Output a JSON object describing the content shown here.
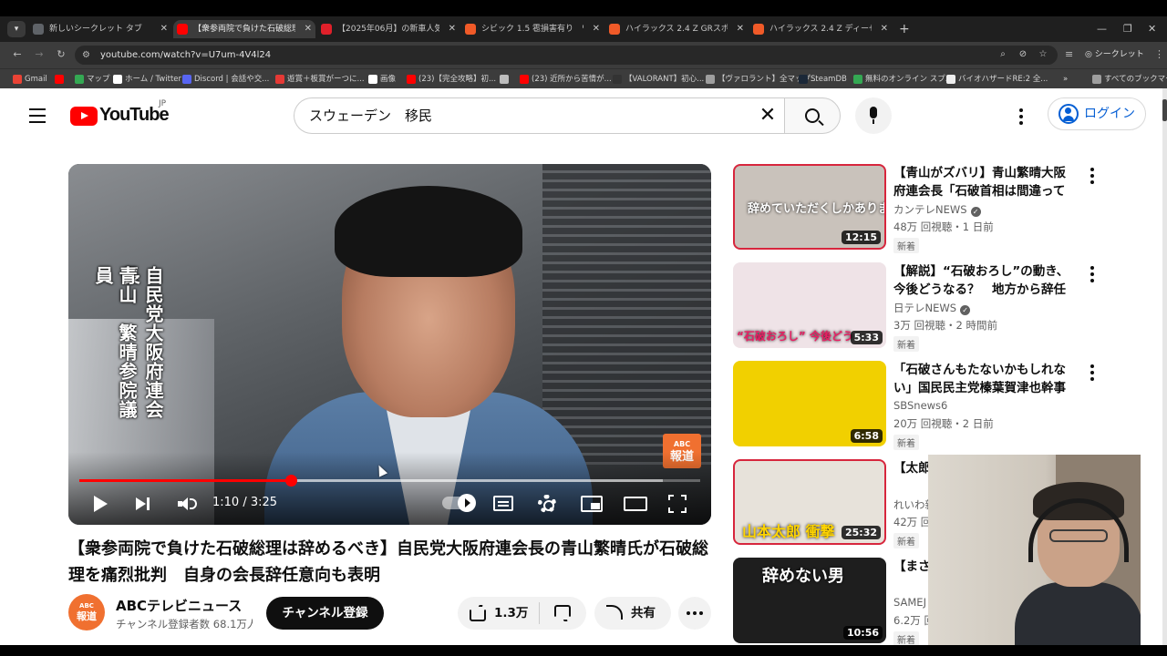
{
  "browser": {
    "tabs": [
      {
        "title": "新しいシークレット タブ",
        "color": "#5f6368",
        "active": false
      },
      {
        "title": "【衆参両院で負けた石破総理は辞",
        "color": "#ff0000",
        "active": true
      },
      {
        "title": "【2025年06月】の新車人気ランキ",
        "color": "#e0202a",
        "active": false
      },
      {
        "title": "シビック 1.5 雹損害有り　ワンオー",
        "color": "#f05a28",
        "active": false
      },
      {
        "title": "ハイラックス 2.4 Z GRスポーツ ディー",
        "color": "#f05a28",
        "active": false
      },
      {
        "title": "ハイラックス 2.4 Z ディーゼルターボ 4",
        "color": "#f05a28",
        "active": false
      }
    ],
    "url": "youtube.com/watch?v=U7um-4V4l24",
    "incognito_label": "シークレット",
    "bookmarks": [
      {
        "label": "Gmail",
        "color": "#ea4335"
      },
      {
        "label": "",
        "color": "#ff0000"
      },
      {
        "label": "マップ",
        "color": "#34a853"
      },
      {
        "label": "ホーム / Twitter",
        "color": "#ffffff"
      },
      {
        "label": "Discord | 会話や交...",
        "color": "#5865f2"
      },
      {
        "label": "遊賞＋板賞がーつに...",
        "color": "#e53935"
      },
      {
        "label": "画像",
        "color": "#ffffff"
      },
      {
        "label": "(23)【完全攻略】初...",
        "color": "#ff0000"
      },
      {
        "label": "",
        "color": "#bdbdbd"
      },
      {
        "label": "(23) 近所から苦情が...",
        "color": "#ff0000"
      },
      {
        "label": "【VALORANT】初心...",
        "color": "#333333"
      },
      {
        "label": "【ヴァロラント】全マップ...",
        "color": "#9e9e9e"
      },
      {
        "label": "SteamDB",
        "color": "#1b2838"
      },
      {
        "label": "無料のオンライン スプ...",
        "color": "#34a853"
      },
      {
        "label": "バイオハザードRE:2 全...",
        "color": "#eeeeee"
      }
    ],
    "all_bookmarks_label": "すべてのブックマーク"
  },
  "youtube": {
    "logo_text": "YouTube",
    "region": "JP",
    "search_query": "スウェーデン　移民",
    "login_label": "ログイン"
  },
  "player": {
    "caption_lines": [
      "自民党大阪府連会長",
      "青山　繁晴参院議員"
    ],
    "bug_top": "ABC",
    "bug_main": "報道",
    "time": "1:10 / 3:25",
    "progress_fraction": 0.341,
    "buffer_fraction": 0.94
  },
  "video": {
    "title": "【衆参両院で負けた石破総理は辞めるべき】自民党大阪府連会長の青山繁晴氏が石破総理を痛烈批判　自身の会長辞任意向も表明",
    "channel_avatar_top": "ABC",
    "channel_avatar_main": "報道",
    "channel_name": "ABCテレビニュース",
    "subscribers": "チャンネル登録者数 68.1万人",
    "subscribe_label": "チャンネル登録",
    "likes": "1.3万",
    "share_label": "共有"
  },
  "recommendations": [
    {
      "title": "【青山がズバリ】青山繁晴大阪府連会長「石破首相は間違っている」",
      "channel": "カンテレNEWS",
      "verified": true,
      "meta": "48万 回視聴・1 日前",
      "badge": "新着",
      "duration": "12:15",
      "thumb_text": "辞めていただくしかありません",
      "thumb_bg": "#c9c2bb"
    },
    {
      "title": "【解説】“石破おろし”の動き、今後どうなる？　地方から辞任要求",
      "channel": "日テレNEWS",
      "verified": true,
      "meta": "3万 回視聴・2 時間前",
      "badge": "新着",
      "duration": "5:33",
      "thumb_text": "“石破おろし” 今後どう",
      "thumb_bg": "#efe3e7"
    },
    {
      "title": "「石破さんもたないかもしれない」国民民主党榛葉賀津也幹事長",
      "channel": "SBSnews6",
      "verified": false,
      "meta": "20万 回視聴・2 日前",
      "badge": "新着",
      "duration": "6:58",
      "thumb_text": "",
      "thumb_bg": "#f1d000"
    },
    {
      "title": "【太郎】首相続投表明",
      "channel": "れいわ新選組",
      "verified": false,
      "meta": "42万 回視聴",
      "badge": "新着",
      "duration": "25:32",
      "thumb_text": "山本太郎 衝撃",
      "thumb_bg": "#e7e2da"
    },
    {
      "title": "【まさかの】が花道",
      "channel": "SAMEJ",
      "verified": false,
      "meta": "6.2万 回視聴",
      "badge": "新着",
      "duration": "10:56",
      "thumb_text": "辞めない男",
      "thumb_bg": "#1e1e1e"
    }
  ]
}
